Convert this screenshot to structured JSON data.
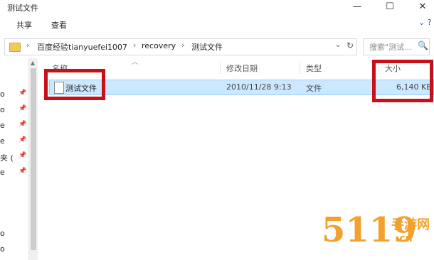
{
  "window": {
    "title": "测试文件",
    "minimize": "—",
    "maximize": "☐",
    "close": "✕"
  },
  "ribbon": {
    "tabs": [
      "共享",
      "查看"
    ],
    "expand": "⌄ ?"
  },
  "address": {
    "crumbs": [
      "百度经验tianyuefei1007",
      "recovery",
      "测试文件"
    ],
    "separator": "›",
    "search_placeholder": "搜索\"测试...",
    "dropdown": "⌄",
    "refresh": "↻"
  },
  "nav": {
    "items": [
      "o",
      "o",
      "e",
      "e",
      "夹 (",
      "e",
      "o",
      "o"
    ],
    "scroll_up": "▲"
  },
  "columns": {
    "name": "名称",
    "date": "修改日期",
    "type": "类型",
    "size": "大小"
  },
  "files": [
    {
      "name": "测试文件",
      "date": "2010/11/28 9:13",
      "type": "文件",
      "size": "6,140 KB"
    }
  ],
  "watermark": {
    "big": "5119",
    "line1": "手游网",
    "line2": ".cn"
  },
  "colors": {
    "selection": "#cce8ff",
    "annotation": "#c8101b",
    "watermark": "#f2a12e"
  }
}
